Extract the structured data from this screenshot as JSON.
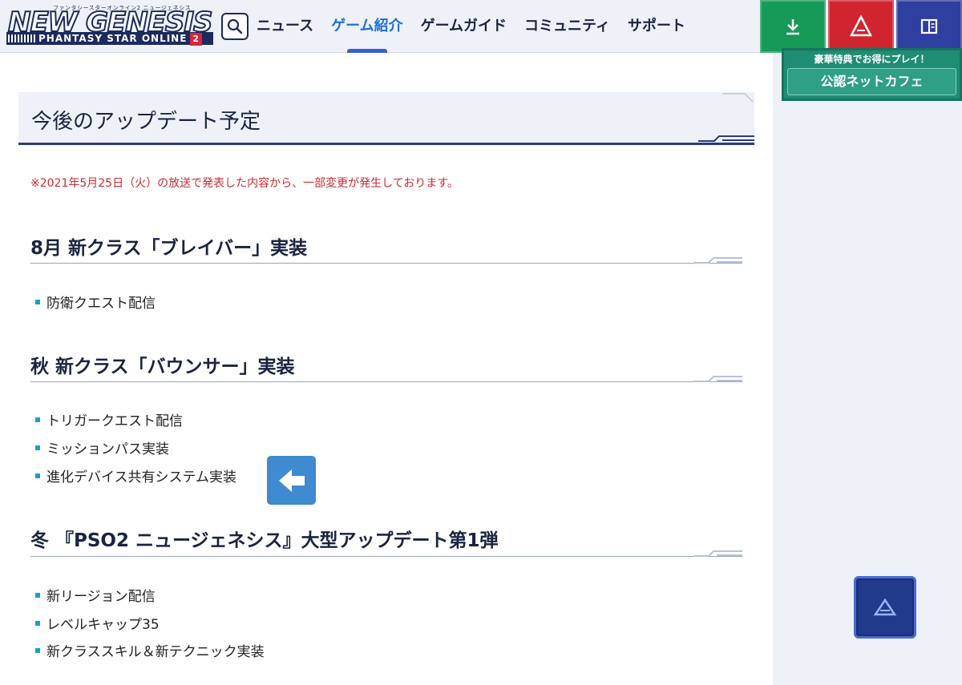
{
  "header": {
    "logo_main": "NEW GENESIS",
    "logo_small": "ファンタシースターオンライン2 ニュージェネシス",
    "logo_sub": "PHANTASY STAR ONLINE",
    "logo_num": "2",
    "nav": [
      {
        "label": "ニュース",
        "active": false
      },
      {
        "label": "ゲーム紹介",
        "active": true
      },
      {
        "label": "ゲームガイド",
        "active": false
      },
      {
        "label": "コミュニティ",
        "active": false
      },
      {
        "label": "サポート",
        "active": false
      }
    ],
    "buttons": [
      {
        "icon": "download-icon",
        "color": "#179a58"
      },
      {
        "icon": "app-icon",
        "color": "#d0242f"
      },
      {
        "icon": "book-icon",
        "color": "#2f3f9f"
      }
    ]
  },
  "sidebar": {
    "cafe_top": "豪華特典でお得にプレイ！",
    "cafe_label": "公認ネットカフェ"
  },
  "main": {
    "title": "今後のアップデート予定",
    "notice": "※2021年5月25日（火）の放送で発表した内容から、一部変更が発生しております。",
    "sections": [
      {
        "title": "8月 新クラス「ブレイバー」実装",
        "items": [
          "防衛クエスト配信"
        ]
      },
      {
        "title": "秋 新クラス「バウンサー」実装",
        "items": [
          "トリガークエスト配信",
          "ミッションパス実装",
          "進化デバイス共有システム実装"
        ]
      },
      {
        "title": "冬 『PSO2 ニュージェネシス』大型アップデート第1弾",
        "items": [
          "新リージョン配信",
          "レベルキャップ35",
          "新クラススキル＆新テクニック実装"
        ]
      }
    ]
  },
  "colors": {
    "accent": "#1e6fd9",
    "notice": "#d02a30",
    "bullet": "#1aa0c8",
    "title_line": "#2a3a80"
  }
}
